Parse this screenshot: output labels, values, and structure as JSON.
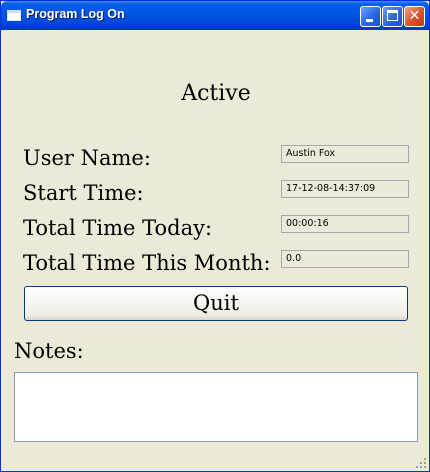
{
  "window": {
    "title": "Program Log On"
  },
  "status": "Active",
  "fields": [
    {
      "label": "User Name:",
      "value": "Austin Fox"
    },
    {
      "label": "Start Time:",
      "value": "17-12-08-14:37:09"
    },
    {
      "label": "Total Time Today:",
      "value": "00:00:16"
    },
    {
      "label": "Total Time This Month:",
      "value": "0.0"
    }
  ],
  "buttons": {
    "quit": "Quit"
  },
  "notes": {
    "label": "Notes:",
    "value": ""
  },
  "colors": {
    "titlebar": "#0055e5",
    "window_bg": "#ece9d8",
    "button_border": "#003c74"
  }
}
